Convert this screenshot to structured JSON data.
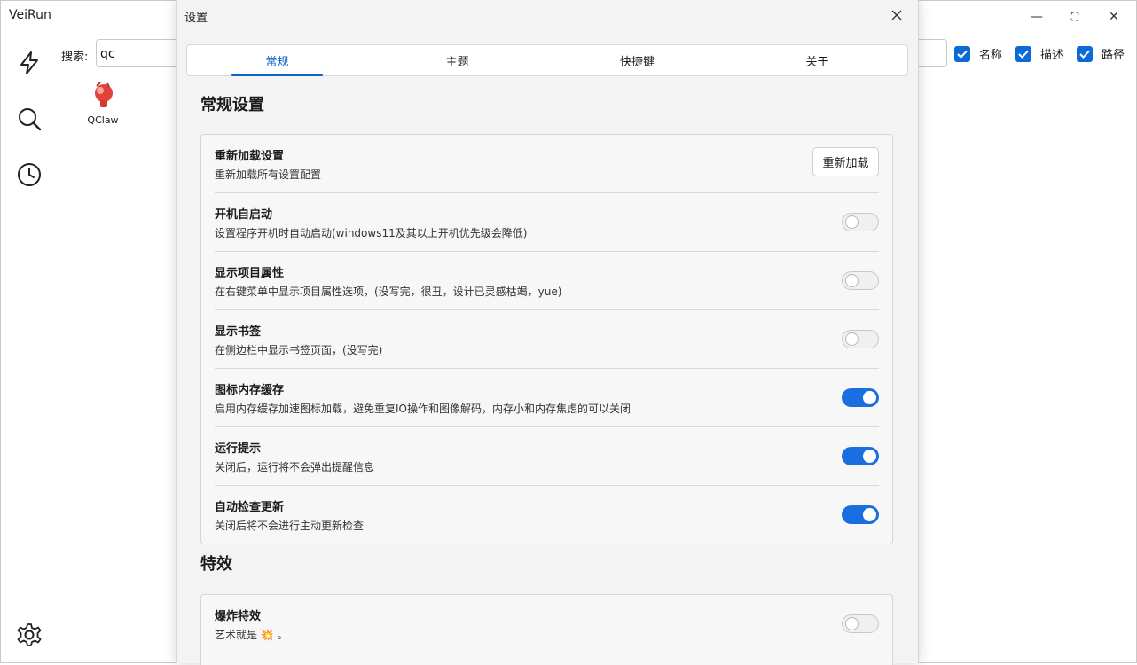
{
  "app": {
    "title": "VeiRun"
  },
  "window_controls": {
    "minimize": "—",
    "maximize": "⛶",
    "close": "✕"
  },
  "sidebar": {
    "icons": [
      "lightning-icon",
      "search-icon",
      "clock-icon",
      "gear-icon"
    ]
  },
  "search": {
    "label": "搜索:",
    "value": "qc"
  },
  "filters": [
    {
      "label": "名称",
      "checked": true
    },
    {
      "label": "描述",
      "checked": true
    },
    {
      "label": "路径",
      "checked": true
    }
  ],
  "results": [
    {
      "label": "QClaw",
      "icon": "qclaw-app-icon"
    }
  ],
  "dialog": {
    "title": "设置",
    "tabs": [
      {
        "label": "常规",
        "active": true
      },
      {
        "label": "主题",
        "active": false
      },
      {
        "label": "快捷键",
        "active": false
      },
      {
        "label": "关于",
        "active": false
      }
    ],
    "general": {
      "title": "常规设置",
      "items": [
        {
          "title": "重新加载设置",
          "desc": "重新加载所有设置配置",
          "control": "button",
          "button_label": "重新加载"
        },
        {
          "title": "开机自启动",
          "desc": "设置程序开机时自动启动(windows11及其以上开机优先级会降低)",
          "control": "toggle",
          "on": false
        },
        {
          "title": "显示项目属性",
          "desc": "在右键菜单中显示项目属性选项，(没写完，很丑，设计已灵感枯竭，yue)",
          "control": "toggle",
          "on": false
        },
        {
          "title": "显示书签",
          "desc": "在侧边栏中显示书签页面，(没写完)",
          "control": "toggle",
          "on": false
        },
        {
          "title": "图标内存缓存",
          "desc": "启用内存缓存加速图标加载，避免重复IO操作和图像解码，内存小和内存焦虑的可以关闭",
          "control": "toggle",
          "on": true
        },
        {
          "title": "运行提示",
          "desc": "关闭后，运行将不会弹出提醒信息",
          "control": "toggle",
          "on": true
        },
        {
          "title": "自动检查更新",
          "desc": "关闭后将不会进行主动更新检查",
          "control": "toggle",
          "on": true
        }
      ]
    },
    "effects": {
      "title": "特效",
      "items": [
        {
          "title": "爆炸特效",
          "desc": "艺术就是 💥 。",
          "control": "toggle",
          "on": false
        }
      ]
    }
  }
}
